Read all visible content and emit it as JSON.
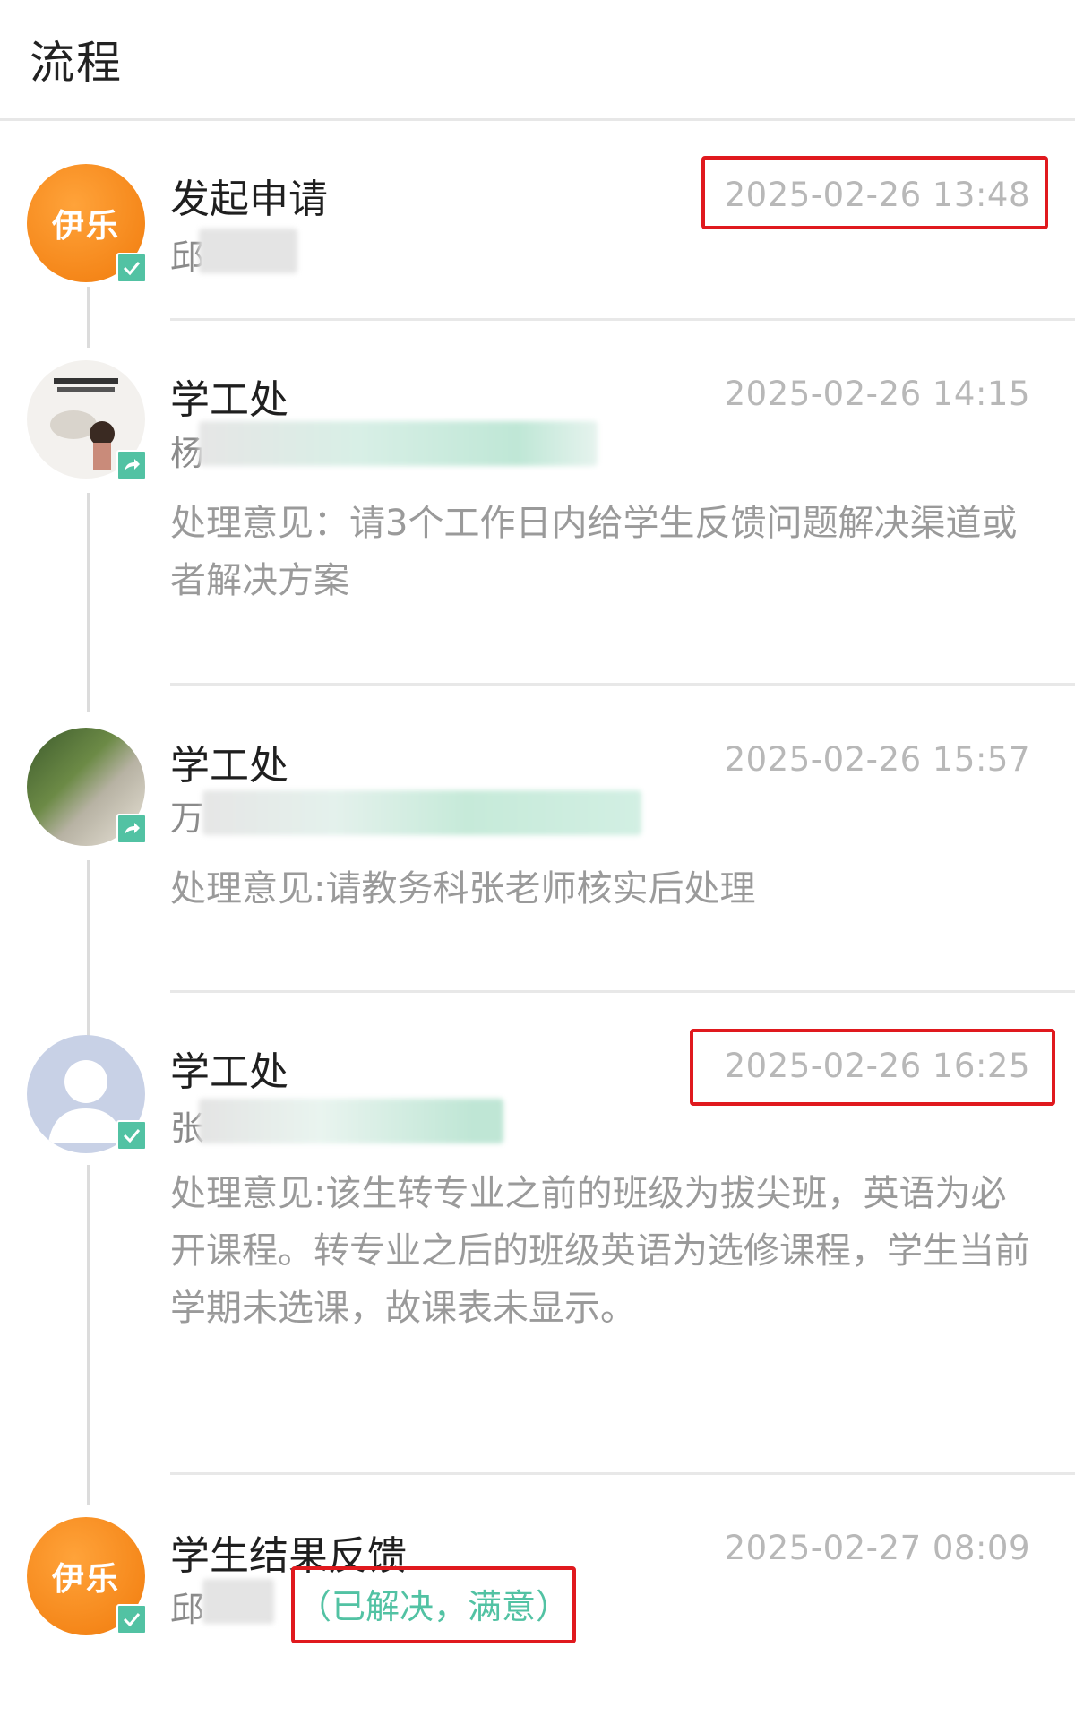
{
  "page": {
    "title": "流程"
  },
  "steps": [
    {
      "title": "发起申请",
      "avatar_text": "伊乐",
      "person_prefix": "邱",
      "time": "2025-02-26 13:48",
      "highlighted": true
    },
    {
      "title": "学工处",
      "person_prefix": "杨",
      "time": "2025-02-26 14:15",
      "opinion": "处理意见：请3个工作日内给学生反馈问题解决渠道或者解决方案"
    },
    {
      "title": "学工处",
      "person_prefix": "万",
      "time": "2025-02-26 15:57",
      "opinion": "处理意见:请教务科张老师核实后处理"
    },
    {
      "title": "学工处",
      "person_prefix": "张",
      "time": "2025-02-26 16:25",
      "opinion": "处理意见:该生转专业之前的班级为拔尖班，英语为必开课程。转专业之后的班级英语为选修课程，学生当前学期未选课，故课表未显示。",
      "highlighted": true
    },
    {
      "title": "学生结果反馈",
      "avatar_text": "伊乐",
      "person_prefix": "邱",
      "time": "2025-02-27 08:09",
      "result": "（已解决，满意）"
    }
  ],
  "colors": {
    "accent_green": "#52c2a3",
    "highlight_red": "#e0191e",
    "avatar_orange": "#f5871a",
    "muted_text": "#9a9a9a"
  },
  "icons": {
    "check_badge": "check-icon",
    "forward_badge": "forward-icon"
  }
}
